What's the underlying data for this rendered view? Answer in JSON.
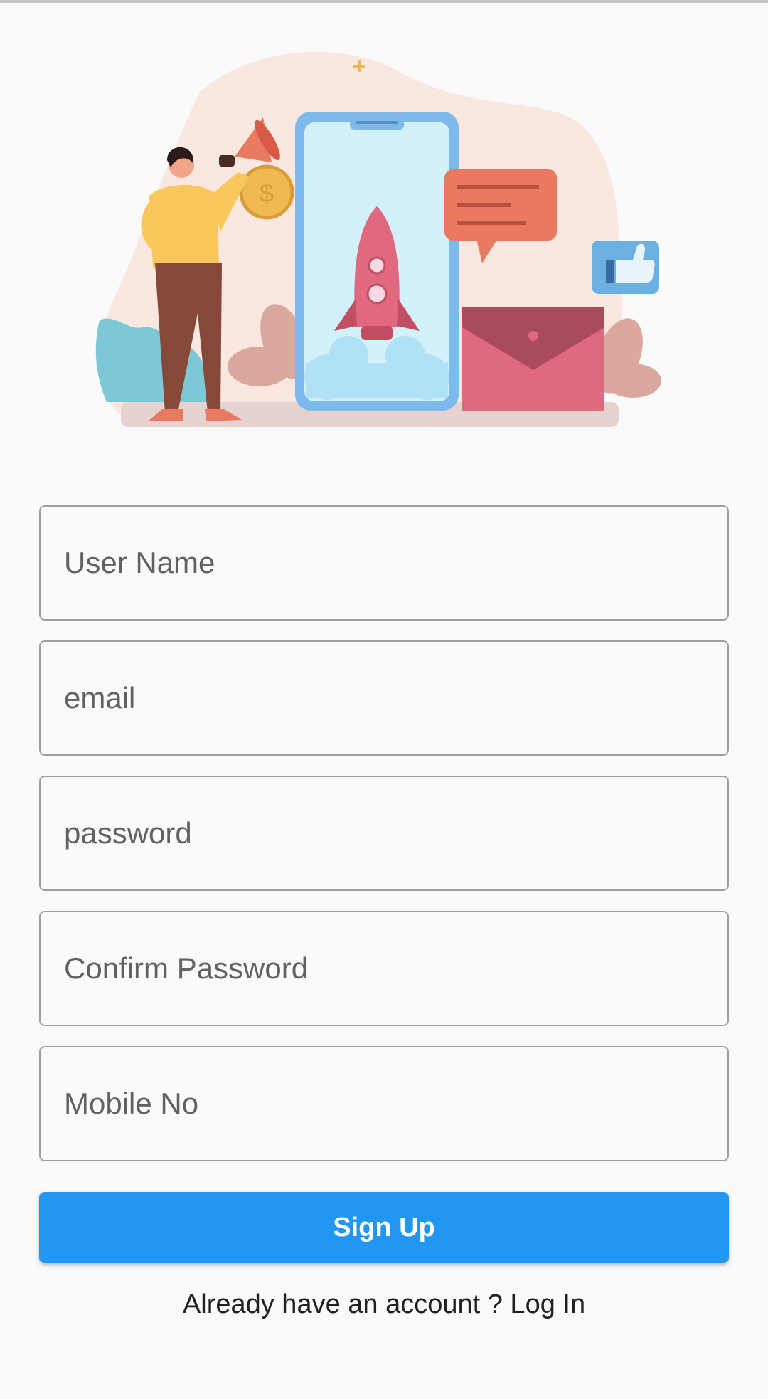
{
  "form": {
    "fields": [
      {
        "id": "username",
        "placeholder": "User Name",
        "value": ""
      },
      {
        "id": "email",
        "placeholder": "email",
        "value": ""
      },
      {
        "id": "password",
        "placeholder": "password",
        "value": ""
      },
      {
        "id": "confirm",
        "placeholder": "Confirm Password",
        "value": ""
      },
      {
        "id": "mobile",
        "placeholder": "Mobile No",
        "value": ""
      }
    ],
    "signup_label": "Sign Up",
    "login_prompt": "Already have an account ? Log In"
  },
  "hero": {
    "coin_symbol": "$"
  },
  "colors": {
    "accent": "#2196f3",
    "background": "#fafafa",
    "field_border": "#9e9e9e"
  }
}
